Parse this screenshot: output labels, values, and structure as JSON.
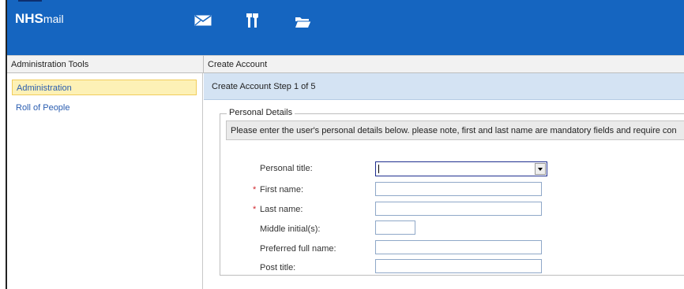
{
  "app": {
    "logo_main": "NHS",
    "logo_sub": "mail"
  },
  "toolbar": {
    "icons": [
      "mail-icon",
      "tools-icon",
      "folder-icon"
    ]
  },
  "left_panel": {
    "title": "Administration Tools",
    "items": [
      {
        "label": "Administration",
        "active": true
      },
      {
        "label": "Roll of People",
        "active": false
      }
    ]
  },
  "main": {
    "title": "Create Account",
    "step": "Create Account Step 1 of 5",
    "section": "Personal Details",
    "info": "Please enter the user's personal details below. please note, first and last name are mandatory fields and require con",
    "required_marker": "*",
    "fields": {
      "personal_title": {
        "label": "Personal title:",
        "value": ""
      },
      "first_name": {
        "label": "First name:",
        "value": ""
      },
      "last_name": {
        "label": "Last name:",
        "value": ""
      },
      "middle_initials": {
        "label": "Middle initial(s):",
        "value": ""
      },
      "preferred_full_name": {
        "label": "Preferred full name:",
        "value": ""
      },
      "post_title": {
        "label": "Post title:",
        "value": ""
      }
    }
  },
  "colors": {
    "brand_blue": "#1565c0",
    "step_bar": "#d4e3f3",
    "active_item": "#fdf1b6",
    "required": "#d0282f",
    "link": "#2a5db0"
  }
}
